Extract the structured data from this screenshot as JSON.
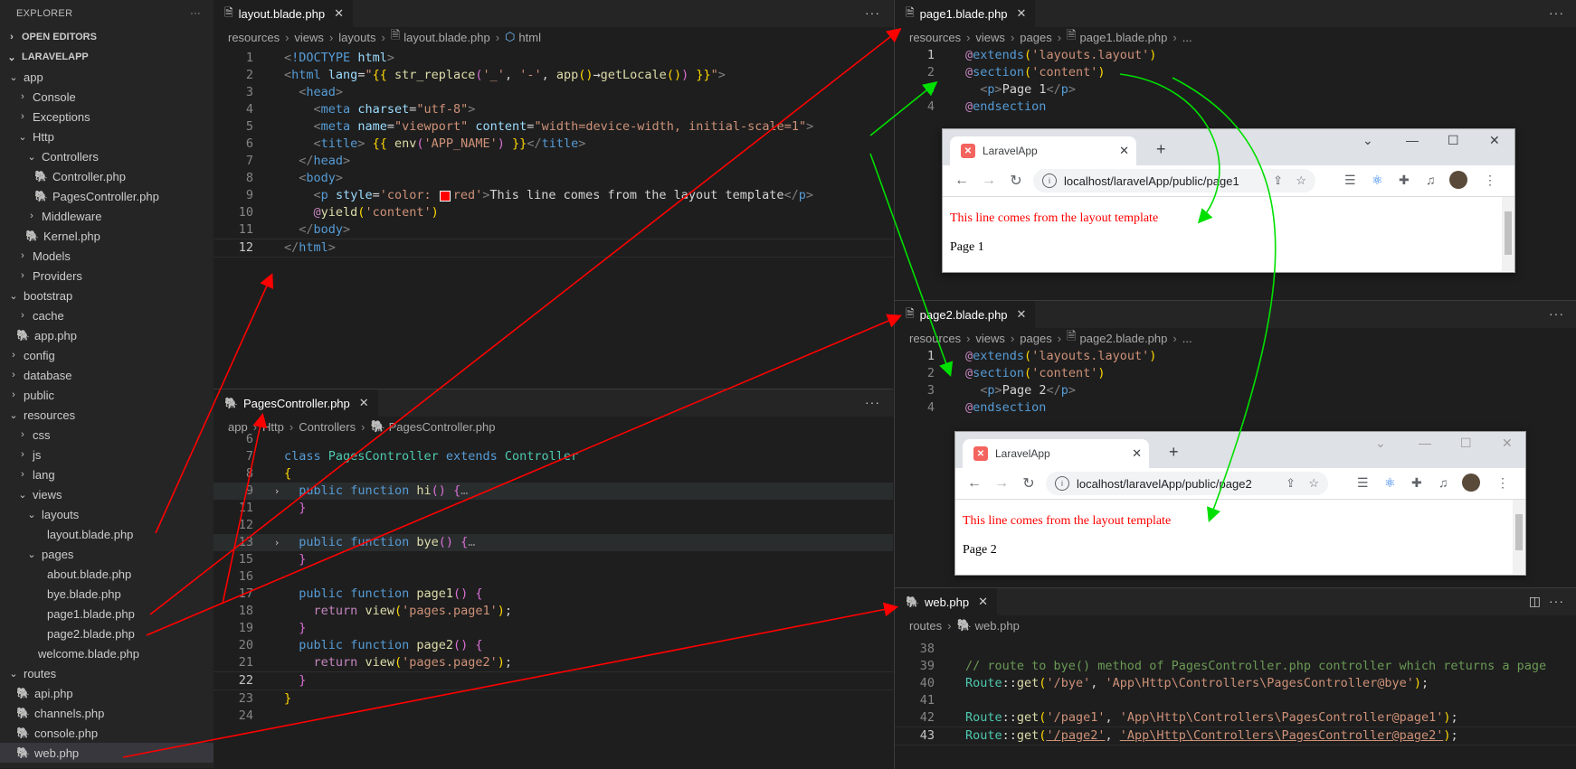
{
  "explorer": {
    "title": "EXPLORER",
    "more": "···",
    "open_editors": "OPEN EDITORS",
    "project": "LARAVELAPP",
    "tree": [
      "app",
      "Console",
      "Exceptions",
      "Http",
      "Controllers",
      "Controller.php",
      "PagesController.php",
      "Middleware",
      "Kernel.php",
      "Models",
      "Providers",
      "bootstrap",
      "cache",
      "app.php",
      "config",
      "database",
      "public",
      "resources",
      "css",
      "js",
      "lang",
      "views",
      "layouts",
      "layout.blade.php",
      "pages",
      "about.blade.php",
      "bye.blade.php",
      "page1.blade.php",
      "page2.blade.php",
      "welcome.blade.php",
      "routes",
      "api.php",
      "channels.php",
      "console.php",
      "web.php"
    ]
  },
  "layout_editor": {
    "tab": "layout.blade.php",
    "crumbs": [
      "resources",
      "views",
      "layouts",
      "layout.blade.php",
      "html"
    ],
    "line_numbers": [
      "1",
      "2",
      "3",
      "4",
      "5",
      "6",
      "7",
      "8",
      "9",
      "10",
      "11",
      "12"
    ]
  },
  "controller_editor": {
    "tab": "PagesController.php",
    "crumbs": [
      "app",
      "Http",
      "Controllers",
      "PagesController.php"
    ],
    "line_numbers": [
      "6",
      "7",
      "8",
      "9",
      "11",
      "12",
      "13",
      "15",
      "16",
      "17",
      "18",
      "19",
      "20",
      "21",
      "22",
      "23",
      "24"
    ]
  },
  "page1_editor": {
    "tab": "page1.blade.php",
    "crumbs": [
      "resources",
      "views",
      "pages",
      "page1.blade.php",
      "..."
    ],
    "line_numbers": [
      "1",
      "2",
      "3",
      "4"
    ]
  },
  "page2_editor": {
    "tab": "page2.blade.php",
    "crumbs": [
      "resources",
      "views",
      "pages",
      "page2.blade.php",
      "..."
    ],
    "line_numbers": [
      "1",
      "2",
      "3",
      "4"
    ]
  },
  "web_editor": {
    "tab": "web.php",
    "crumbs": [
      "routes",
      "web.php"
    ],
    "line_numbers": [
      "38",
      "39",
      "40",
      "41",
      "42",
      "43"
    ]
  },
  "browser1": {
    "tab_title": "LaravelApp",
    "url": "localhost/laravelApp/public/page1",
    "red_text": "This line comes from the layout template",
    "page_text": "Page 1"
  },
  "browser2": {
    "tab_title": "LaravelApp",
    "url": "localhost/laravelApp/public/page2",
    "red_text": "This line comes from the layout template",
    "page_text": "Page 2"
  },
  "colors": {
    "red_arrow": "#ff0000",
    "green_arrow": "#00e000",
    "editor_bg": "#1e1e1e",
    "sidebar_bg": "#252526"
  }
}
